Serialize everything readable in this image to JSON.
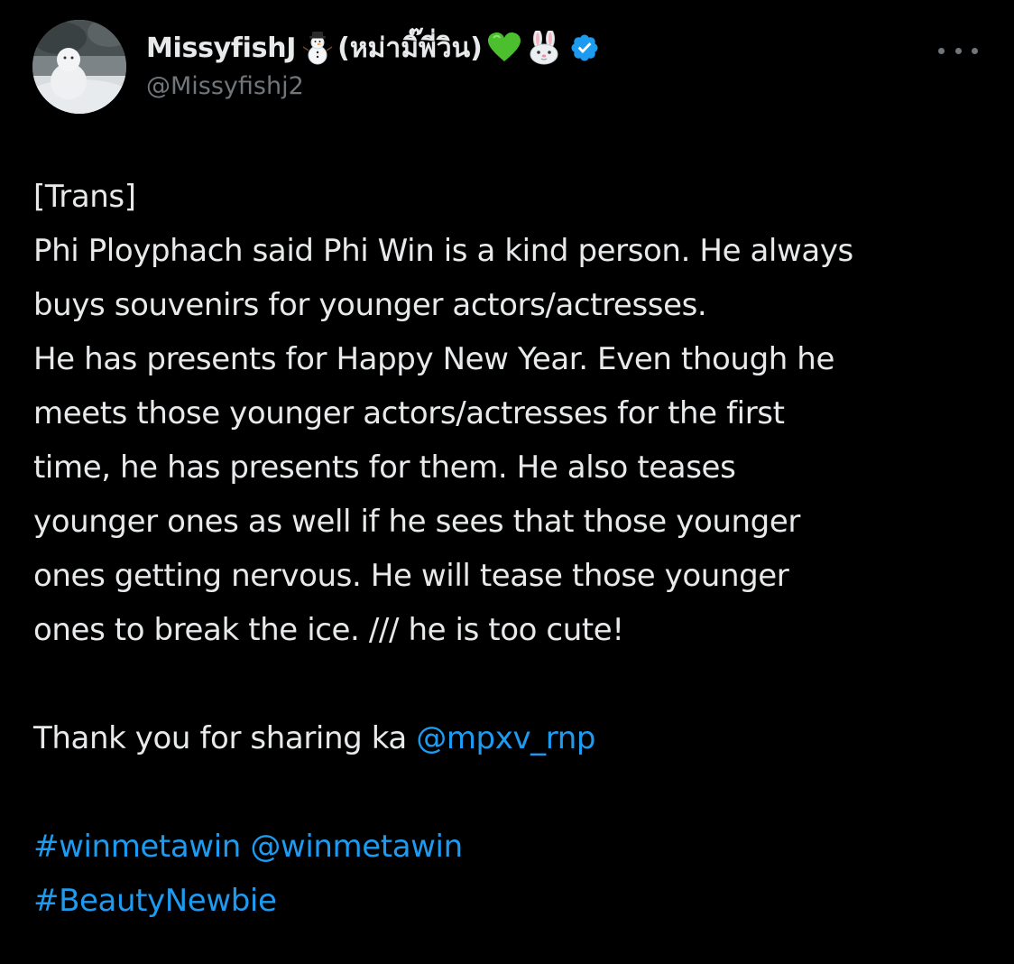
{
  "author": {
    "display_name": "MissyfishJ",
    "name_suffix": "(หม่ามิ๊พี่วิน)",
    "handle": "@Missyfishj2",
    "emojis": [
      "snowman",
      "green-heart",
      "rabbit-face"
    ],
    "verified": true
  },
  "post": {
    "lines": [
      "[Trans]",
      "Phi Ployphach said Phi Win is a kind person. He always",
      "buys souvenirs for younger actors/actresses.",
      "He has presents for Happy New Year. Even though he",
      "meets those younger actors/actresses for the first",
      "time, he has presents for them. He also teases",
      "younger ones as well if he sees that those younger",
      "ones getting nervous. He will tease those younger",
      "ones to break the ice. /// he is too cute!"
    ],
    "thanks_text": "Thank you for sharing ka ",
    "thanks_mention": "@mpxv_rnp",
    "hashtag_1": "#winmetawin",
    "mention_2": "@winmetawin",
    "hashtag_2": "#BeautyNewbie"
  },
  "colors": {
    "background": "#000000",
    "text": "#e7e9ea",
    "secondary": "#71767b",
    "link": "#1d9bf0",
    "verified": "#1d9bf0"
  },
  "icons": {
    "more": "more-horizontal-icon",
    "verified": "verified-badge-icon"
  }
}
